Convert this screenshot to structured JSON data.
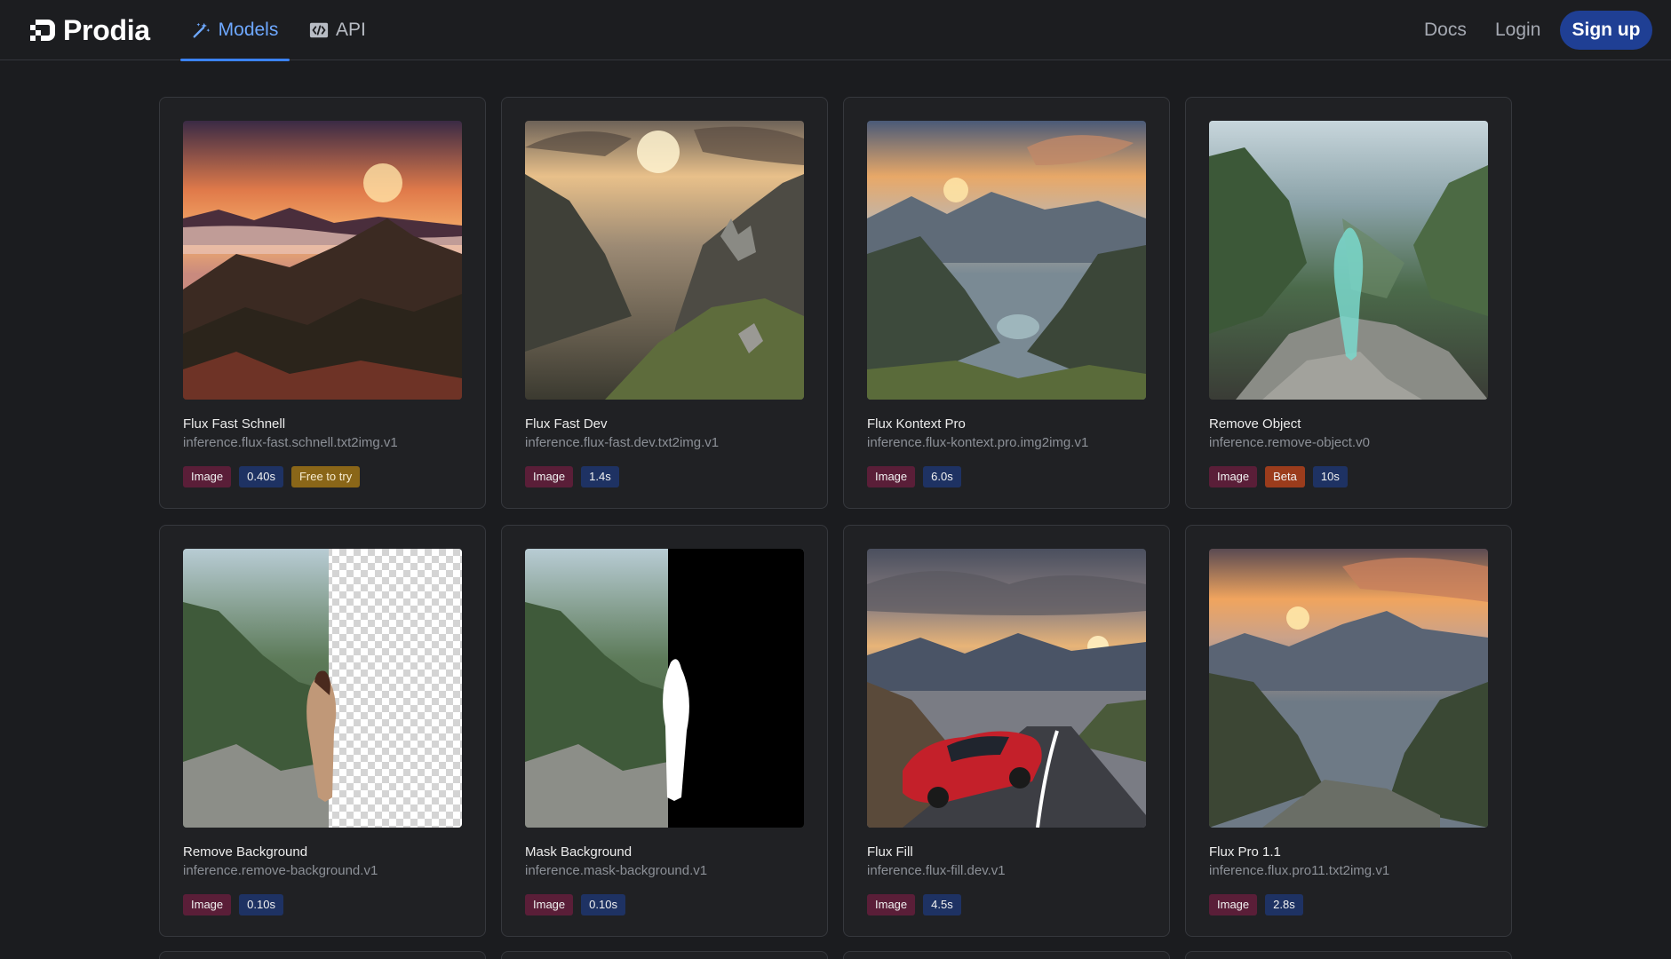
{
  "header": {
    "brand": "Prodia",
    "tabs": [
      {
        "label": "Models",
        "icon": "wand-icon",
        "active": true
      },
      {
        "label": "API",
        "icon": "code-icon",
        "active": false
      }
    ],
    "links": {
      "docs": "Docs",
      "login": "Login"
    },
    "signup_label": "Sign up",
    "colors": {
      "accent": "#3b82f6",
      "signup_bg": "#1f3f94",
      "background": "#1b1c1f"
    }
  },
  "models": [
    {
      "title": "Flux Fast Schnell",
      "id": "inference.flux-fast.schnell.txt2img.v1",
      "tags": [
        {
          "label": "Image",
          "kind": "type"
        },
        {
          "label": "0.40s",
          "kind": "time"
        },
        {
          "label": "Free to try",
          "kind": "free"
        }
      ]
    },
    {
      "title": "Flux Fast Dev",
      "id": "inference.flux-fast.dev.txt2img.v1",
      "tags": [
        {
          "label": "Image",
          "kind": "type"
        },
        {
          "label": "1.4s",
          "kind": "time"
        }
      ]
    },
    {
      "title": "Flux Kontext Pro",
      "id": "inference.flux-kontext.pro.img2img.v1",
      "tags": [
        {
          "label": "Image",
          "kind": "type"
        },
        {
          "label": "6.0s",
          "kind": "time"
        }
      ]
    },
    {
      "title": "Remove Object",
      "id": "inference.remove-object.v0",
      "tags": [
        {
          "label": "Image",
          "kind": "type"
        },
        {
          "label": "Beta",
          "kind": "beta"
        },
        {
          "label": "10s",
          "kind": "time"
        }
      ]
    },
    {
      "title": "Remove Background",
      "id": "inference.remove-background.v1",
      "tags": [
        {
          "label": "Image",
          "kind": "type"
        },
        {
          "label": "0.10s",
          "kind": "time"
        }
      ]
    },
    {
      "title": "Mask Background",
      "id": "inference.mask-background.v1",
      "tags": [
        {
          "label": "Image",
          "kind": "type"
        },
        {
          "label": "0.10s",
          "kind": "time"
        }
      ]
    },
    {
      "title": "Flux Fill",
      "id": "inference.flux-fill.dev.v1",
      "tags": [
        {
          "label": "Image",
          "kind": "type"
        },
        {
          "label": "4.5s",
          "kind": "time"
        }
      ]
    },
    {
      "title": "Flux Pro 1.1",
      "id": "inference.flux.pro11.txt2img.v1",
      "tags": [
        {
          "label": "Image",
          "kind": "type"
        },
        {
          "label": "2.8s",
          "kind": "time"
        }
      ]
    }
  ]
}
